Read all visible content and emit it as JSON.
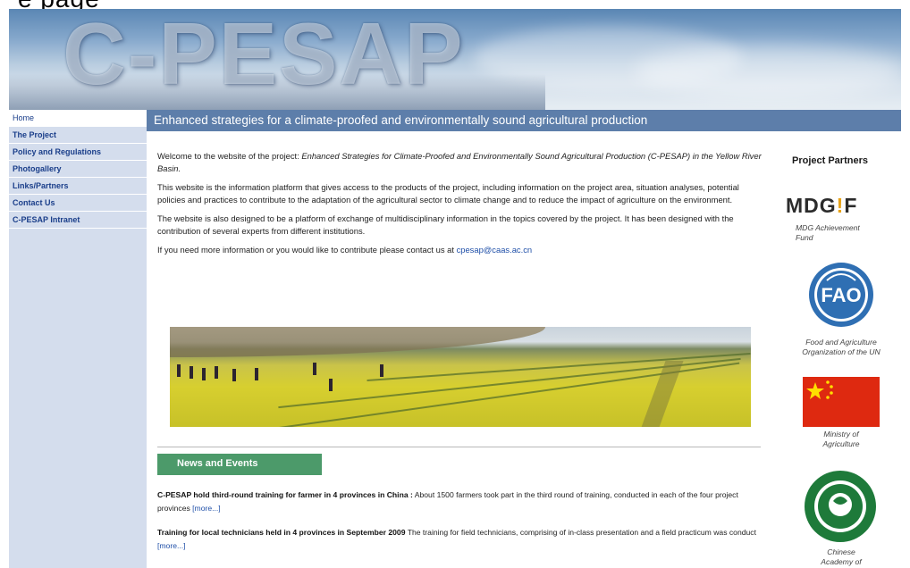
{
  "top_cut_text": "e page",
  "banner": {
    "logo": "C-PESAP"
  },
  "nav": {
    "items": [
      {
        "label": "Home",
        "active": true
      },
      {
        "label": "The Project"
      },
      {
        "label": "Policy and Regulations"
      },
      {
        "label": "Photogallery"
      },
      {
        "label": "Links/Partners"
      },
      {
        "label": "Contact Us"
      },
      {
        "label": "C-PESAP Intranet"
      }
    ]
  },
  "title_bar": "Enhanced strategies for a climate-proofed and environmentally sound agricultural production",
  "intro": {
    "p1_prefix": "Welcome to the website of the project: ",
    "p1_italic": "Enhanced Strategies for Climate-Proofed and Environmentally Sound Agricultural Production (C-PESAP) in the Yellow River Basin.",
    "p2": "This website is the information platform that gives access to the products of the project, including information on the project area, situation analyses, potential policies and practices to contribute to the adaptation of the agricultural sector to climate change and to reduce the impact of agriculture on the environment.",
    "p3": "The website is also designed to be a platform of exchange of multidisciplinary information in the topics covered by the project. It has been designed with the contribution of several experts from different institutions.",
    "p4_prefix": "If you need more information or you would like to contribute please contact us at ",
    "p4_email": "cpesap@caas.ac.cn"
  },
  "news": {
    "heading": "News and Events",
    "items": [
      {
        "title": "C-PESAP hold third-round training for farmer in 4 provinces in China :",
        "body": " About 1500 farmers took part in the third round of training, conducted in each of the four project provinces ",
        "more": "[more...]"
      },
      {
        "title": "Training for local technicians held in 4 provinces in September 2009",
        "body": " The training for field technicians, comprising of in-class presentation and a field practicum was conduct ",
        "more": "[more...]"
      }
    ]
  },
  "partners": {
    "heading": "Project Partners",
    "mdg_logo_a": "MDG",
    "mdg_logo_i": "!",
    "mdg_logo_b": "F",
    "mdg_caption_1": "MDG Achievement",
    "mdg_caption_2": "Fund",
    "fao_caption_1": "Food and Agriculture",
    "fao_caption_2": "Organization of the UN",
    "moa_caption_1": "Ministry of",
    "moa_caption_2": "Agriculture",
    "caas_caption_1": "Chinese",
    "caas_caption_2": "Academy of"
  },
  "colors": {
    "title_bar": "#5d7eaa",
    "sidebar": "#d4dded",
    "nav_text": "#1a3e8a",
    "news_head": "#4c9a6a",
    "link": "#1f4fa8"
  }
}
